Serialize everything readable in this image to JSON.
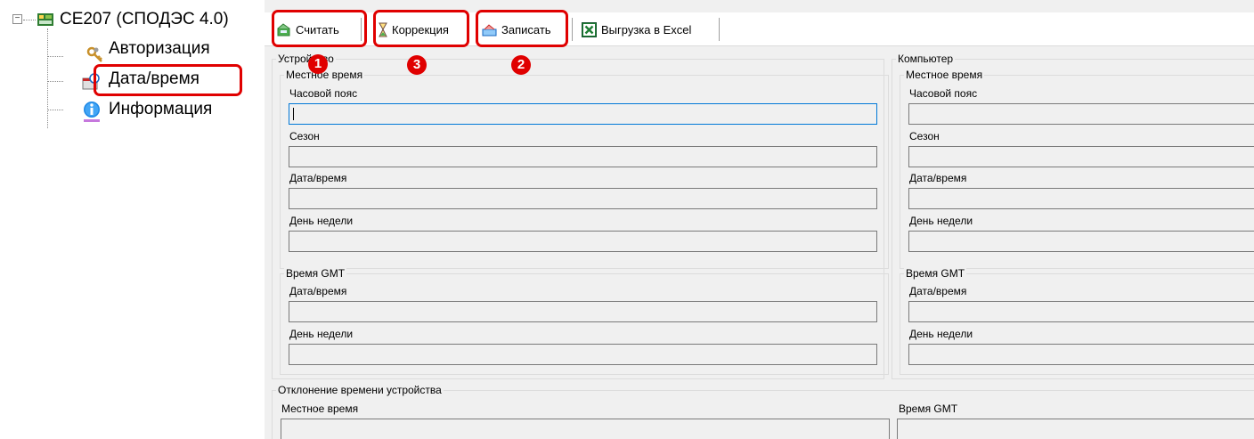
{
  "tree": {
    "root_label": "CE207 (СПОДЭС 4.0)",
    "expander": "−",
    "items": [
      {
        "label": "Авторизация",
        "icon": "keys-icon"
      },
      {
        "label": "Дата/время",
        "icon": "calendar-clock-icon",
        "highlighted": true
      },
      {
        "label": "Информация",
        "icon": "info-icon"
      }
    ]
  },
  "toolbar": {
    "read_label": "Считать",
    "correction_label": "Коррекция",
    "write_label": "Записать",
    "excel_label": "Выгрузка в Excel"
  },
  "badges": {
    "read": "1",
    "write": "2",
    "correction": "3"
  },
  "device": {
    "title": "Устройство",
    "local": {
      "title": "Местное время",
      "timezone_label": "Часовой пояс",
      "season_label": "Сезон",
      "datetime_label": "Дата/время",
      "weekday_label": "День недели"
    },
    "gmt": {
      "title": "Время GMT",
      "datetime_label": "Дата/время",
      "weekday_label": "День недели"
    }
  },
  "computer": {
    "title": "Компьютер",
    "local": {
      "title": "Местное время",
      "timezone_label": "Часовой пояс",
      "season_label": "Сезон",
      "datetime_label": "Дата/время",
      "weekday_label": "День недели"
    },
    "gmt": {
      "title": "Время GMT",
      "datetime_label": "Дата/время",
      "weekday_label": "День недели"
    }
  },
  "deviation": {
    "title": "Отклонение времени устройства",
    "local_label": "Местное время",
    "gmt_label": "Время GMT"
  },
  "colors": {
    "highlight": "#e00000",
    "focus": "#0078d7",
    "panel_bg": "#f0f0f0"
  }
}
